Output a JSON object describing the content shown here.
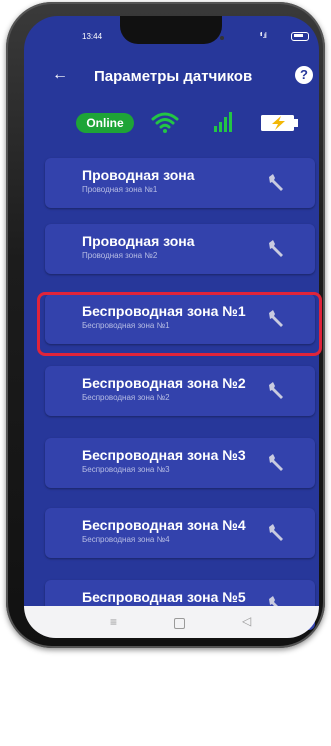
{
  "status_bar": {
    "time": "13:44",
    "signal": "ᵗᴵˡ .ıl"
  },
  "header": {
    "title": "Параметры датчиков",
    "back_icon": "arrow-left-icon",
    "help_label": "?"
  },
  "status_row": {
    "online_label": "Online",
    "colors": {
      "online": "#1ea437",
      "wifi": "#23c545",
      "battery": "#f2b707"
    }
  },
  "zones": [
    {
      "title": "Проводная зона",
      "subtitle": "Проводная зона  №1",
      "selected": false
    },
    {
      "title": "Проводная зона",
      "subtitle": "Проводная зона  №2",
      "selected": false
    },
    {
      "title": "Беспроводная зона №1",
      "subtitle": "Беспроводная зона  №1",
      "selected": true
    },
    {
      "title": "Беспроводная зона №2",
      "subtitle": "Беспроводная зона  №2",
      "selected": false
    },
    {
      "title": "Беспроводная зона №3",
      "subtitle": "Беспроводная зона  №3",
      "selected": false
    },
    {
      "title": "Беспроводная зона №4",
      "subtitle": "Беспроводная зона  №4",
      "selected": false
    },
    {
      "title": "Беспроводная зона №5",
      "subtitle": "",
      "selected": false
    }
  ],
  "nav": {
    "menu": "≡",
    "back": "◁"
  },
  "colors": {
    "background": "#27379a",
    "card": "#3342ac",
    "highlight": "#e0243a"
  }
}
